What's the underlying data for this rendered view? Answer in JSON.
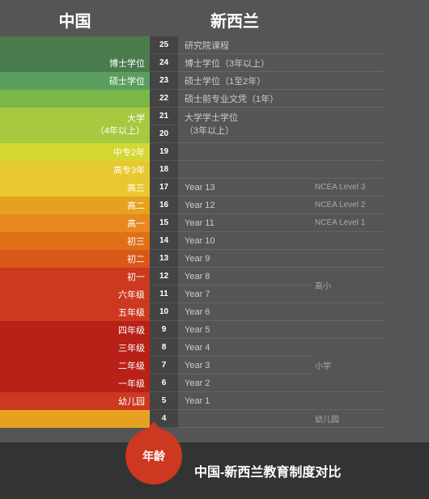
{
  "header": {
    "china_label": "中国",
    "nz_label": "新西兰"
  },
  "rows": [
    {
      "num": 25,
      "china": "",
      "china_rows": 1,
      "nz": "研究院课程",
      "nz_rows": 1,
      "ncea": "",
      "color": "c-dark-green"
    },
    {
      "num": 24,
      "china": "博士学位",
      "china_rows": 1,
      "nz": "博士学位（3年以上）",
      "nz_rows": 1,
      "ncea": "",
      "color": "c-dark-green"
    },
    {
      "num": 23,
      "china": "硕士学位",
      "china_rows": 1,
      "nz": "硕士学位（1至2年）",
      "nz_rows": 1,
      "ncea": "",
      "color": "c-green"
    },
    {
      "num": 22,
      "china": "",
      "china_rows": 1,
      "nz": "硕士前专业文凭（1年）",
      "nz_rows": 1,
      "ncea": "",
      "color": "c-light-green"
    },
    {
      "num": 21,
      "china": "大学",
      "china_rows": 3,
      "nz": "大学学士学位",
      "nz_rows": 3,
      "ncea": "",
      "color": "c-yellow-green"
    },
    {
      "num": 20,
      "china": "（4年以上）",
      "china_rows": 0,
      "nz": "（3年以上）",
      "nz_rows": 0,
      "ncea": "",
      "color": "c-yellow-green"
    },
    {
      "num": 19,
      "china": "中专2年",
      "china_rows": 1,
      "nz": "",
      "nz_rows": 0,
      "ncea": "",
      "color": "c-yellow"
    },
    {
      "num": 18,
      "china": "高专3年",
      "china_rows": 1,
      "nz": "",
      "nz_rows": 0,
      "ncea": "",
      "color": "c-yellow"
    },
    {
      "num": 17,
      "china": "高三",
      "china_rows": 1,
      "nz": "Year 13",
      "nz_rows": 1,
      "ncea": "NCEA Level 3",
      "color": "c-orange-yellow"
    },
    {
      "num": 16,
      "china": "高二",
      "china_rows": 1,
      "nz": "Year 12",
      "nz_rows": 1,
      "ncea": "NCEA Level 2",
      "color": "c-orange"
    },
    {
      "num": 15,
      "china": "高一",
      "china_rows": 1,
      "nz": "Year 11",
      "nz_rows": 1,
      "ncea": "NCEA Level 1",
      "color": "c-orange2"
    },
    {
      "num": 14,
      "china": "初三",
      "china_rows": 1,
      "nz": "Year 10",
      "nz_rows": 1,
      "ncea": "",
      "color": "c-orange3"
    },
    {
      "num": 13,
      "china": "初二",
      "china_rows": 1,
      "nz": "Year 9",
      "nz_rows": 1,
      "ncea": "",
      "color": "c-red-orange"
    },
    {
      "num": 12,
      "china": "初一",
      "china_rows": 1,
      "nz": "Year 8",
      "nz_rows": 1,
      "ncea": "",
      "color": "c-red"
    },
    {
      "num": 11,
      "china": "六年级",
      "china_rows": 1,
      "nz": "Year 7",
      "nz_rows": 1,
      "ncea": "",
      "color": "c-red"
    },
    {
      "num": 10,
      "china": "五年级",
      "china_rows": 1,
      "nz": "Year 6",
      "nz_rows": 1,
      "ncea": "",
      "color": "c-red"
    },
    {
      "num": 9,
      "china": "四年级",
      "china_rows": 1,
      "nz": "Year 5",
      "nz_rows": 1,
      "ncea": "",
      "color": "c-dark-red"
    },
    {
      "num": 8,
      "china": "三年级",
      "china_rows": 1,
      "nz": "Year 4",
      "nz_rows": 1,
      "ncea": "",
      "color": "c-dark-red"
    },
    {
      "num": 7,
      "china": "二年级",
      "china_rows": 1,
      "nz": "Year 3",
      "nz_rows": 1,
      "ncea": "",
      "color": "c-dark-red"
    },
    {
      "num": 6,
      "china": "一年级",
      "china_rows": 1,
      "nz": "Year 2",
      "nz_rows": 1,
      "ncea": "",
      "color": "c-dark-red"
    },
    {
      "num": 5,
      "china": "幼儿园",
      "china_rows": 1,
      "nz": "Year 1",
      "nz_rows": 1,
      "ncea": "",
      "color": "c-red"
    },
    {
      "num": 4,
      "china": "",
      "china_rows": 1,
      "nz": "",
      "nz_rows": 1,
      "ncea": "幼儿园",
      "color": "c-orange"
    }
  ],
  "side_labels": {
    "gaoxiao": "高小",
    "xiaoxue": "小学",
    "youeryuan_nz": "幼儿园"
  },
  "footer": {
    "age_label": "年龄",
    "title": "中国-新西兰教育制度对比"
  }
}
